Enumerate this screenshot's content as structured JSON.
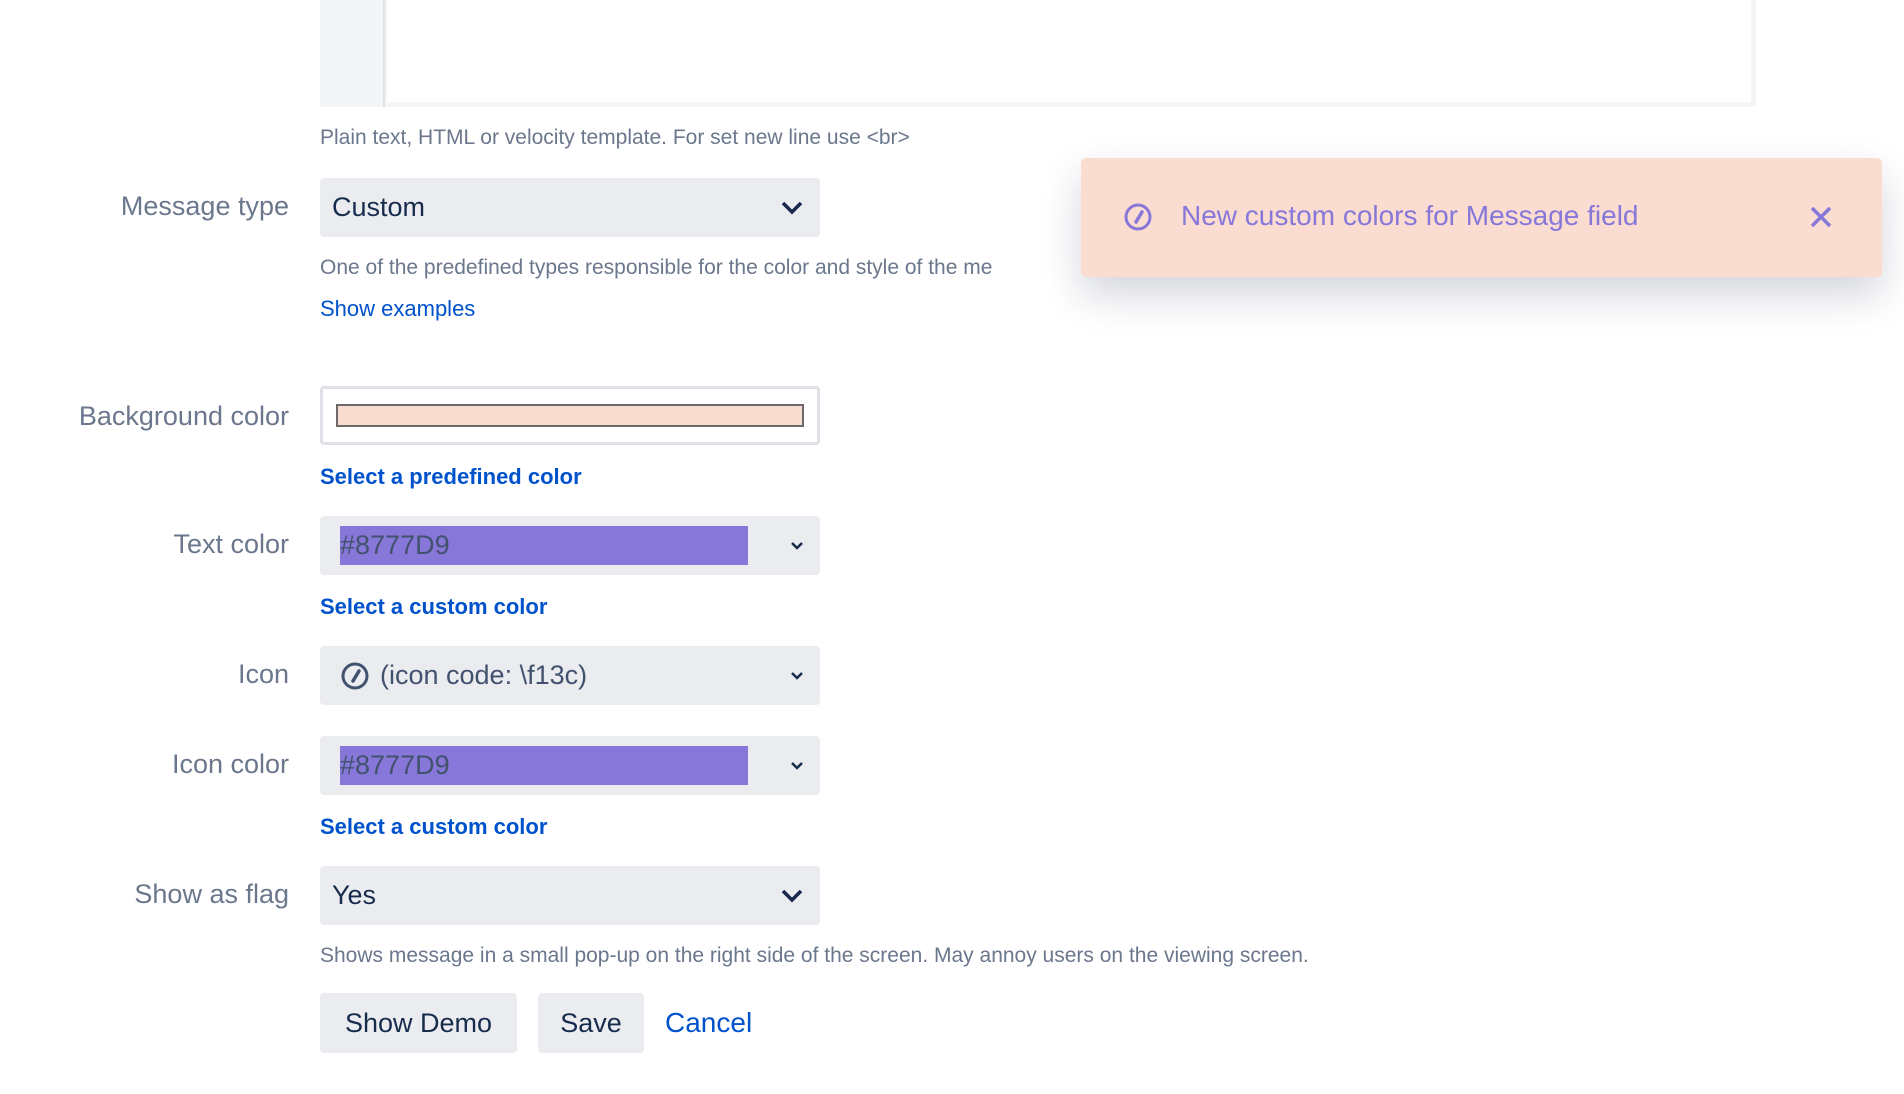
{
  "template_help": "Plain text, HTML or velocity template. For set new line use <br>",
  "message_type": {
    "label": "Message type",
    "value": "Custom",
    "help": "One of the predefined types responsible for the color and style of the me",
    "link": "Show examples"
  },
  "background_color": {
    "label": "Background color",
    "value": "#FADCD1",
    "link": "Select a predefined color"
  },
  "text_color": {
    "label": "Text color",
    "value": "#8777D9",
    "link": "Select a custom color"
  },
  "icon": {
    "label": "Icon",
    "value": "(icon code: \\f13c)",
    "icon": "compass-icon"
  },
  "icon_color": {
    "label": "Icon color",
    "value": "#8777D9",
    "link": "Select a custom color"
  },
  "show_as_flag": {
    "label": "Show as flag",
    "value": "Yes",
    "help": "Shows message in a small pop-up on the right side of the screen. May annoy users on the viewing screen."
  },
  "buttons": {
    "demo": "Show Demo",
    "save": "Save",
    "cancel": "Cancel"
  },
  "toast": {
    "message": "New custom colors for Message field",
    "bg": "#FADCD1",
    "color": "#8777D9"
  }
}
